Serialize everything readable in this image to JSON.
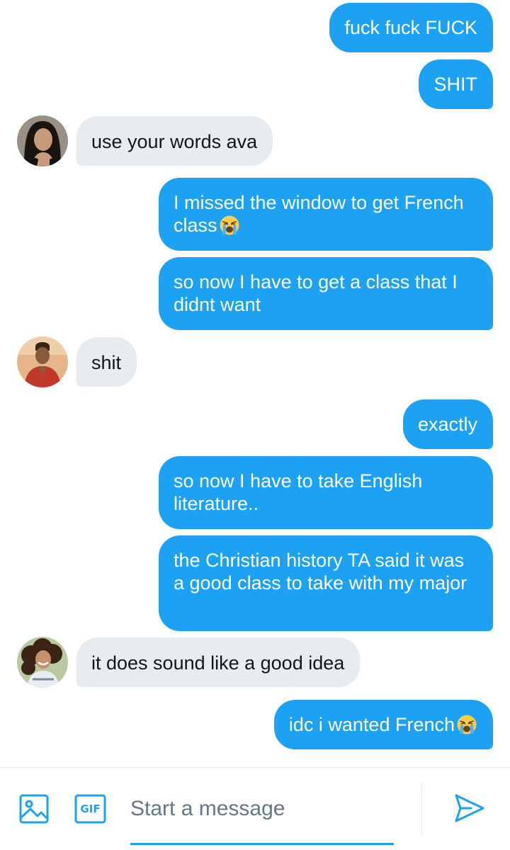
{
  "messages": [
    {
      "dir": "out",
      "text": "fuck fuck FUCK"
    },
    {
      "dir": "out",
      "text": "SHIT"
    },
    {
      "dir": "in",
      "text": "use your words ava",
      "avatar": "avatar-woman-dark-hair"
    },
    {
      "dir": "out",
      "text": "I missed the window to get French class",
      "emoji": "loudly-crying-face"
    },
    {
      "dir": "out",
      "text": "so now I have to get a class that I didnt want"
    },
    {
      "dir": "in",
      "text": "shit",
      "avatar": "avatar-man-red-shirt"
    },
    {
      "dir": "out",
      "text": "exactly"
    },
    {
      "dir": "out",
      "text": "so now I have to take English literature.."
    },
    {
      "dir": "out",
      "text": "the Christian history TA said it was a good class to take with my major"
    },
    {
      "dir": "in",
      "text": "it does sound like a good idea",
      "avatar": "avatar-woman-curly-hair"
    },
    {
      "dir": "out",
      "text": "idc i wanted French",
      "emoji": "loudly-crying-face"
    }
  ],
  "composer": {
    "placeholder": "Start a message",
    "gif_label": "GIF",
    "icons": {
      "media": "image-icon",
      "gif": "gif-icon",
      "send": "send-icon"
    }
  },
  "colors": {
    "outgoing_bubble": "#1da1f2",
    "incoming_bubble": "#e6ecf0",
    "accent": "#1da1f2"
  }
}
